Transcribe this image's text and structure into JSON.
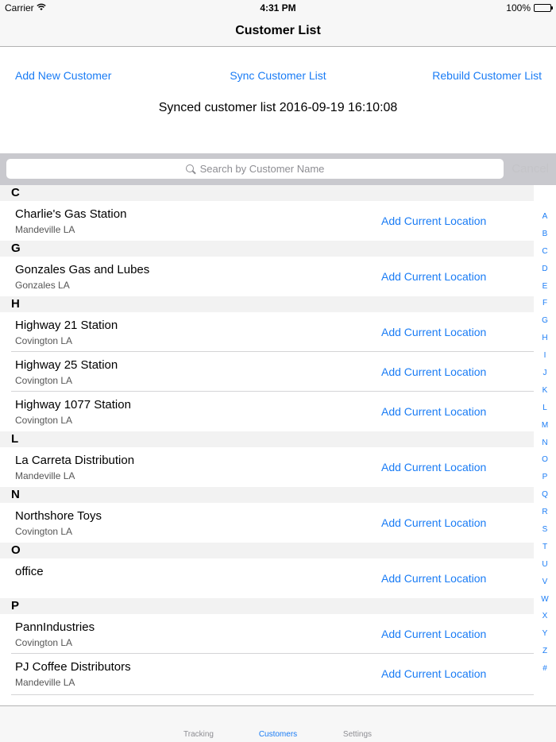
{
  "status_bar": {
    "carrier": "Carrier",
    "time": "4:31 PM",
    "battery": "100%"
  },
  "nav": {
    "title": "Customer List"
  },
  "actions": {
    "add": "Add New Customer",
    "sync": "Sync Customer List",
    "rebuild": "Rebuild Customer List",
    "sync_status": "Synced customer list 2016-09-19 16:10:08"
  },
  "search": {
    "placeholder": "Search by Customer Name",
    "cancel": "Cancel"
  },
  "sections": [
    {
      "letter": "C",
      "rows": [
        {
          "name": "Charlie's Gas Station",
          "city": "Mandeville LA",
          "action": "Add Current Location"
        }
      ]
    },
    {
      "letter": "G",
      "rows": [
        {
          "name": "Gonzales Gas and Lubes",
          "city": "Gonzales LA",
          "action": "Add Current Location"
        }
      ]
    },
    {
      "letter": "H",
      "rows": [
        {
          "name": "Highway 21 Station",
          "city": "Covington LA",
          "action": "Add Current Location"
        },
        {
          "name": "Highway 25 Station",
          "city": "Covington LA",
          "action": "Add Current Location"
        },
        {
          "name": "Highway 1077 Station",
          "city": "Covington LA",
          "action": "Add Current Location"
        }
      ]
    },
    {
      "letter": "L",
      "rows": [
        {
          "name": "La Carreta Distribution",
          "city": "Mandeville LA",
          "action": "Add Current Location"
        }
      ]
    },
    {
      "letter": "N",
      "rows": [
        {
          "name": "Northshore Toys",
          "city": "Covington LA",
          "action": "Add Current Location"
        }
      ]
    },
    {
      "letter": "O",
      "rows": [
        {
          "name": "office",
          "city": "",
          "action": "Add Current Location"
        }
      ]
    },
    {
      "letter": "P",
      "rows": [
        {
          "name": "PannIndustries",
          "city": "Covington LA",
          "action": "Add Current Location"
        },
        {
          "name": "PJ Coffee Distributors",
          "city": "Mandeville LA",
          "action": "Add Current Location"
        }
      ]
    }
  ],
  "index_letters": [
    "A",
    "B",
    "C",
    "D",
    "E",
    "F",
    "G",
    "H",
    "I",
    "J",
    "K",
    "L",
    "M",
    "N",
    "O",
    "P",
    "Q",
    "R",
    "S",
    "T",
    "U",
    "V",
    "W",
    "X",
    "Y",
    "Z",
    "#"
  ],
  "tabs": [
    {
      "label": "Tracking",
      "active": false
    },
    {
      "label": "Customers",
      "active": true
    },
    {
      "label": "Settings",
      "active": false
    }
  ],
  "colors": {
    "accent": "#1a7cf5",
    "inactive_tab": "#8e8e93"
  }
}
